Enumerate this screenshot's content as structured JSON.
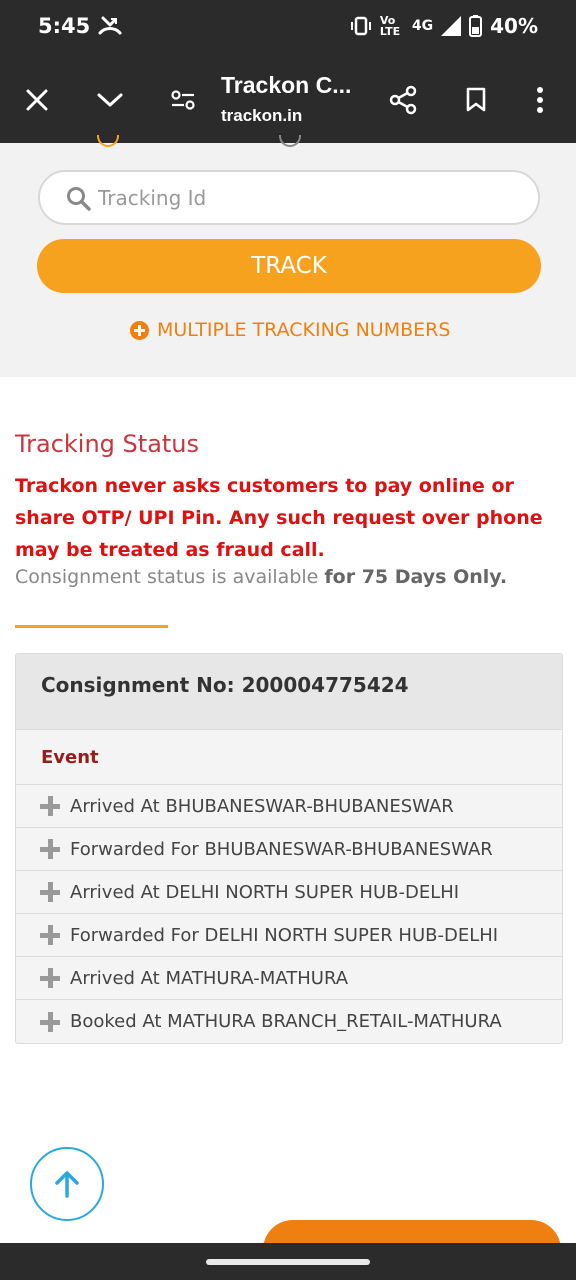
{
  "status_bar": {
    "time": "5:45",
    "network_volte": "Vo LTE",
    "network_type": "4G",
    "battery": "40%",
    "icons": [
      "missed-call-icon",
      "vibrate-icon",
      "signal-icon",
      "battery-icon"
    ]
  },
  "toolbar": {
    "title": "Trackon C...",
    "url": "trackon.in",
    "icons": [
      "close-icon",
      "chevron-down-icon",
      "site-settings-icon",
      "share-icon",
      "bookmark-icon",
      "more-vert-icon"
    ]
  },
  "search": {
    "placeholder": "Tracking Id",
    "track_label": "TRACK",
    "multiple_label": "MULTIPLE TRACKING NUMBERS"
  },
  "status": {
    "title": "Tracking Status",
    "fraud_note": "Trackon never asks customers to pay online or share OTP/ UPI Pin. Any such request over phone may be treated as fraud call.",
    "availability_prefix": "Consignment status is available ",
    "availability_bold": "for 75 Days Only."
  },
  "consignment": {
    "label": "Consignment No: 200004775424",
    "event_header": "Event",
    "events": [
      "Arrived At BHUBANESWAR-BHUBANESWAR",
      "Forwarded For BHUBANESWAR-BHUBANESWAR",
      "Arrived At DELHI NORTH SUPER HUB-DELHI",
      "Forwarded For DELHI NORTH SUPER HUB-DELHI",
      "Arrived At MATHURA-MATHURA",
      "Booked At MATHURA BRANCH_RETAIL-MATHURA"
    ]
  },
  "colors": {
    "accent_orange": "#f7a21e",
    "link_orange": "#f07f12",
    "title_red": "#c9363f",
    "warning_red": "#e01010",
    "scroll_blue": "#29a8e0"
  }
}
